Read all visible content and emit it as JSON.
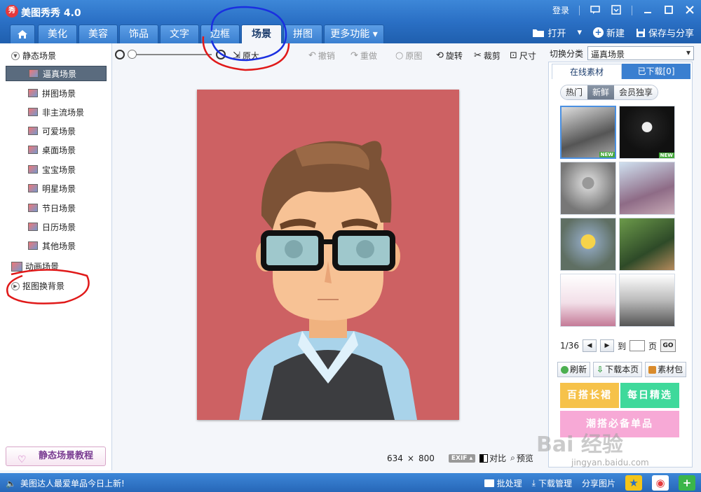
{
  "app": {
    "title": "美图秀秀 4.0",
    "logo_text": "秀"
  },
  "titlebar": {
    "login": "登录"
  },
  "tabs": [
    {
      "label": ""
    },
    {
      "label": "美化"
    },
    {
      "label": "美容"
    },
    {
      "label": "饰品"
    },
    {
      "label": "文字"
    },
    {
      "label": "边框"
    },
    {
      "label": "场景"
    },
    {
      "label": "拼图"
    },
    {
      "label": "更多功能 ▾"
    }
  ],
  "active_tab": "场景",
  "file_actions": {
    "open": "打开",
    "open_arrow": "▾",
    "new": "新建",
    "save": "保存与分享"
  },
  "left_panel": {
    "static_group": "静态场景",
    "static_items": [
      {
        "label": "逼真场景"
      },
      {
        "label": "拼图场景"
      },
      {
        "label": "非主流场景"
      },
      {
        "label": "可爱场景"
      },
      {
        "label": "桌面场景"
      },
      {
        "label": "宝宝场景"
      },
      {
        "label": "明星场景"
      },
      {
        "label": "节日场景"
      },
      {
        "label": "日历场景"
      },
      {
        "label": "其他场景"
      }
    ],
    "animated_group": "动画场景",
    "cutout_group": "抠图换背景",
    "tutorial_button": "静态场景教程"
  },
  "edit_toolbar": {
    "original_size": "原大",
    "undo": "撤销",
    "redo": "重做",
    "original": "原图",
    "rotate": "旋转",
    "crop": "裁剪",
    "resize": "尺寸"
  },
  "canvas": {
    "width_px": "634",
    "times": "×",
    "height_px": "800",
    "exif": "EXIF ▴",
    "compare": "对比",
    "preview": "预览"
  },
  "right_panel": {
    "switch_label": "切换分类",
    "category_value": "逼真场景",
    "tabs": [
      {
        "label": "在线素材"
      },
      {
        "label": "已下载[0]"
      }
    ],
    "filters": [
      {
        "label": "热门"
      },
      {
        "label": "新鲜"
      },
      {
        "label": "会员独享"
      }
    ],
    "active_filter": "新鲜",
    "new_tag": "NEW",
    "pager": {
      "page": "1/36",
      "prev": "◀",
      "next": "▶",
      "goto_label": "到",
      "page_suffix": "页",
      "go": "GO"
    },
    "actions": {
      "refresh": "刷新",
      "download_page": "下载本页",
      "material_pack": "素材包"
    },
    "banners": {
      "b1": "百搭长裙",
      "b2": "每日精选",
      "b3": "潮搭必备单品"
    }
  },
  "statusbar": {
    "news": "美图达人最爱单品今日上新!",
    "batch": "批处理",
    "download_mgr": "下载管理",
    "share": "分享图片",
    "plus": "+"
  },
  "watermark": {
    "line1": "Bai 经验",
    "line2": "jingyan.baidu.com"
  },
  "colors": {
    "titlebar": "#2a6fc4",
    "photo_bg": "#cd6163",
    "annotation_red": "#e01919",
    "annotation_blue": "#1a2fe0"
  }
}
